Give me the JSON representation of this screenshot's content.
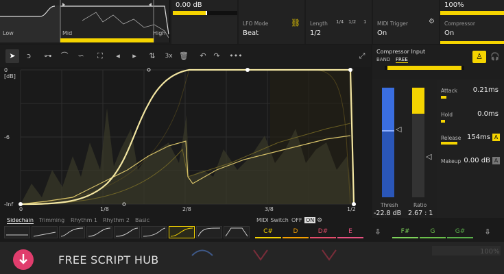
{
  "top": {
    "mini_spectrum": {
      "low_label": "Low",
      "mid_label": "Mid",
      "high_label": "High"
    },
    "gain_value": "0.00 dB",
    "mix_value": "100%",
    "lfo_mode": {
      "title": "LFO Mode",
      "value": "Beat"
    },
    "length": {
      "title": "Length",
      "value": "1/2",
      "options": [
        "1/4",
        "1/2",
        "1"
      ]
    },
    "midi_trigger": {
      "title": "MIDI Trigger",
      "value": "On"
    },
    "compressor": {
      "title": "Compressor",
      "value": "On"
    }
  },
  "toolbar": {
    "zoom_label": "3x"
  },
  "graph": {
    "y_unit": "[dB]",
    "y_labels": {
      "top": "0",
      "mid": "-6",
      "bottom": "-Inf"
    },
    "x_labels": {
      "x0": "0",
      "x1": "1/8",
      "x2": "2/8",
      "x3": "3/8",
      "x4": "1/2"
    }
  },
  "compressor_panel": {
    "input_title": "Compressor Input",
    "band_label": "BAND",
    "free_label": "FREE",
    "thresh_label": "Thresh",
    "thresh_value": "-22.8 dB",
    "ratio_label": "Ratio",
    "ratio_value": "2.67 : 1",
    "attack": {
      "label": "Attack",
      "value": "0.21ms"
    },
    "hold": {
      "label": "Hold",
      "value": "0.0ms"
    },
    "release": {
      "label": "Release",
      "value": "154ms",
      "auto": "A"
    },
    "makeup": {
      "label": "Makeup",
      "value": "0.00 dB",
      "auto": "A"
    }
  },
  "shape_tabs": {
    "items": [
      "Sidechain",
      "Trimming",
      "Rhythm 1",
      "Rhythm 2",
      "Basic"
    ],
    "midi_switch_label": "MIDI Switch",
    "off_label": "OFF",
    "on_label": "ON",
    "notes": [
      "C#",
      "D",
      "D#",
      "E",
      "F#",
      "G",
      "G#"
    ]
  },
  "footer": {
    "banner_text": "FREE SCRIPT HUB",
    "mix_ghost": "100%"
  },
  "colors": {
    "accent": "#f5d400",
    "note_d_sharp": "#e54d6b"
  }
}
